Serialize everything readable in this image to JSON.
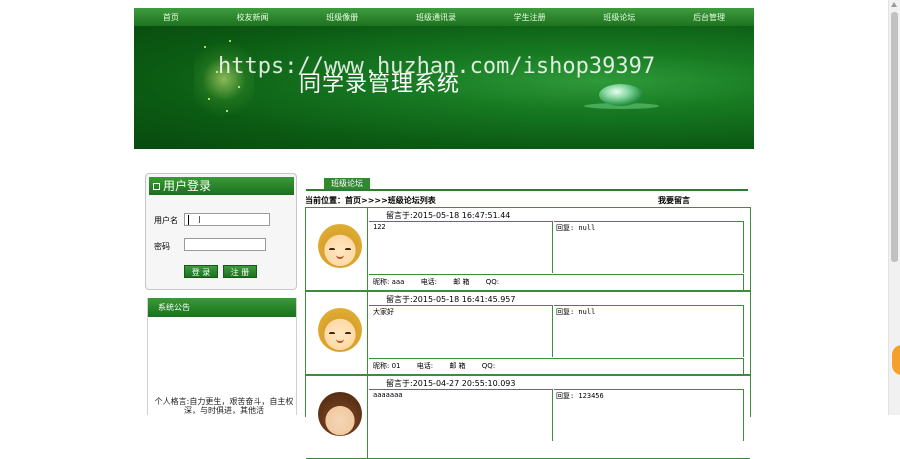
{
  "nav": {
    "items": [
      "首页",
      "校友新闻",
      "班级像册",
      "班级通讯录",
      "学生注册",
      "班级论坛",
      "后台管理"
    ]
  },
  "banner": {
    "title": "同学录管理系统",
    "watermark": "https://www.huzhan.com/ishop39397"
  },
  "login": {
    "title": "用户登录",
    "username_label": "用户名",
    "password_label": "密码",
    "username_value": "",
    "password_value": "",
    "login_button": "登 录",
    "register_button": "注 册"
  },
  "notice": {
    "title": "系统公告",
    "text": "个人格言:自力更生，艰苦奋斗，自主权深，与时俱进，其他活"
  },
  "forum": {
    "tab": "班级论坛",
    "breadcrumb": "当前位置：首页>>>>班级论坛列表",
    "write_link": "我要留言",
    "posts": [
      {
        "time": "留言于:2015-05-18 16:47:51.44",
        "content": "122",
        "reply": "回复: null",
        "nickname": "昵称: aaa",
        "phone": "电话:",
        "email": "邮 箱",
        "qq": "QQ:"
      },
      {
        "time": "留言于:2015-05-18 16:41:45.957",
        "content": "大家好",
        "reply": "回复: null",
        "nickname": "昵称: 01",
        "phone": "电话:",
        "email": "邮 箱",
        "qq": "QQ:"
      },
      {
        "time": "留言于:2015-04-27 20:55:10.093",
        "content": "aaaaaaa",
        "reply": "回复: 123456",
        "nickname": "",
        "phone": "",
        "email": "",
        "qq": ""
      }
    ]
  },
  "colors": {
    "brand_green": "#1d7320",
    "border_green": "#3c8c3c",
    "floating_button": "#f4a02a"
  }
}
